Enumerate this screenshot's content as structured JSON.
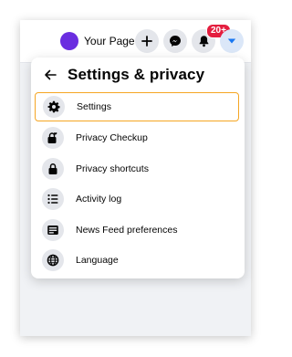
{
  "topbar": {
    "profile_name": "Your Page",
    "notification_badge": "20+"
  },
  "panel": {
    "title": "Settings & privacy",
    "items": [
      {
        "label": "Settings",
        "icon": "gear-icon",
        "selected": true
      },
      {
        "label": "Privacy Checkup",
        "icon": "lock-heart-icon"
      },
      {
        "label": "Privacy shortcuts",
        "icon": "lock-icon"
      },
      {
        "label": "Activity log",
        "icon": "list-icon"
      },
      {
        "label": "News Feed preferences",
        "icon": "feed-icon"
      },
      {
        "label": "Language",
        "icon": "globe-icon"
      }
    ]
  },
  "colors": {
    "accent": "#f5a623",
    "badge": "#e41e3f",
    "avatar": "#6a2de0",
    "button_bg": "#e4e6eb",
    "account_btn": "#1877f2"
  }
}
